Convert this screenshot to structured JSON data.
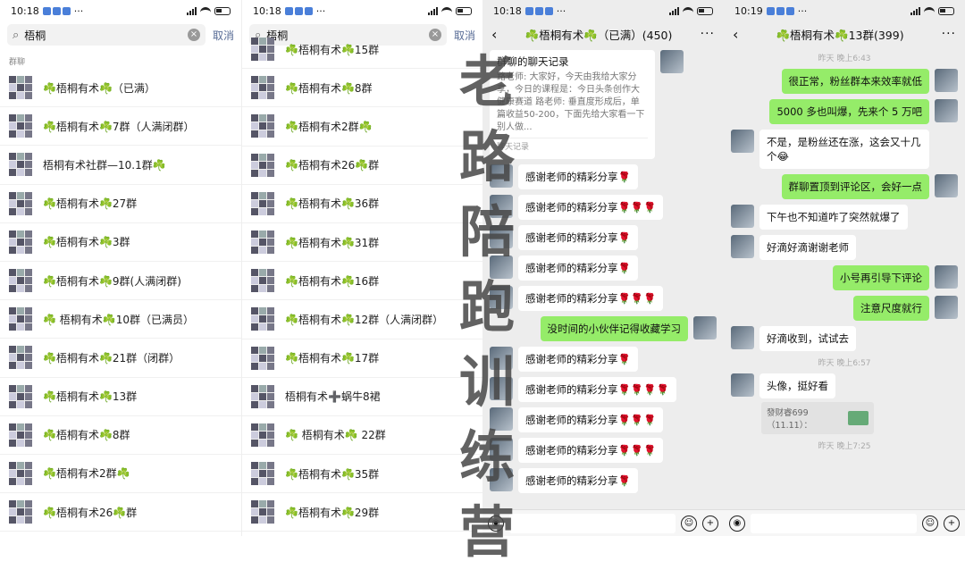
{
  "colors": {
    "bubble_green": "#95ec69",
    "link_blue": "#576b95",
    "clover": "#3aa64a"
  },
  "panel1": {
    "time": "10:18",
    "search_query": "梧桐",
    "cancel": "取消",
    "section": "群聊",
    "groups": [
      "☘️梧桐有术☘️（已满）",
      "☘️梧桐有术☘️7群（人满闭群）",
      "梧桐有术社群—10.1群☘️",
      "☘️梧桐有术☘️27群",
      "☘️梧桐有术☘️3群",
      "☘️梧桐有术☘️9群(人满闭群)",
      "☘️ 梧桐有术☘️10群（已满员）",
      "☘️梧桐有术☘️21群（闭群）",
      "☘️梧桐有术☘️13群",
      "☘️梧桐有术☘️8群",
      "☘️梧桐有术2群☘️",
      "☘️梧桐有术26☘️群"
    ]
  },
  "panel2": {
    "time": "10:18",
    "search_query": "梧桐",
    "cancel": "取消",
    "groups": [
      "☘️梧桐有术☘️15群",
      "☘️梧桐有术☘️8群",
      "☘️梧桐有术2群☘️",
      "☘️梧桐有术26☘️群",
      "☘️梧桐有术☘️36群",
      "☘️梧桐有术☘️31群",
      "☘️梧桐有术☘️16群",
      "☘️梧桐有术☘️12群（人满闭群）",
      "☘️梧桐有术☘️17群",
      "梧桐有术➕蜗牛8裙",
      "☘️ 梧桐有术☘️ 22群",
      "☘️梧桐有术☘️35群",
      "☘️梧桐有术☘️29群"
    ]
  },
  "panel3": {
    "time": "10:18",
    "title": "☘️梧桐有术☘️（已满）(450)",
    "card": {
      "title": "群聊的聊天记录",
      "body": "路老师: 大家好，今天由我给大家分享，今日的课程是：今日头条创作大健康赛道 路老师: 垂直度形成后，单篇收益50-200，下面先给大家看一下别人做...",
      "footer": "聊天记录"
    },
    "messages": [
      {
        "side": "left",
        "text": "感谢老师的精彩分享🌹"
      },
      {
        "side": "left",
        "text": "感谢老师的精彩分享🌹🌹🌹"
      },
      {
        "side": "left",
        "text": "感谢老师的精彩分享🌹"
      },
      {
        "side": "left",
        "text": "感谢老师的精彩分享🌹"
      },
      {
        "side": "left",
        "text": "感谢老师的精彩分享🌹🌹🌹"
      },
      {
        "side": "right",
        "text": "没时间的小伙伴记得收藏学习"
      },
      {
        "side": "left",
        "text": "感谢老师的精彩分享🌹"
      },
      {
        "side": "left",
        "text": "感谢老师的精彩分享🌹🌹🌹🌹"
      },
      {
        "side": "left",
        "text": "感谢老师的精彩分享🌹🌹🌹"
      },
      {
        "side": "left",
        "text": "感谢老师的精彩分享🌹🌹🌹"
      },
      {
        "side": "left",
        "text": "感谢老师的精彩分享🌹"
      }
    ]
  },
  "panel4": {
    "time": "10:19",
    "title": "☘️梧桐有术☘️13群(399)",
    "time1": "昨天 晚上6:43",
    "messages1": [
      {
        "side": "right",
        "text": "很正常，粉丝群本来效率就低"
      },
      {
        "side": "right",
        "text": "5000 多也叫爆，先来个 5 万吧"
      },
      {
        "side": "left",
        "text": "不是，是粉丝还在涨，这会又十几个😂"
      },
      {
        "side": "right",
        "text": "群聊置顶到评论区，会好一点"
      },
      {
        "side": "left",
        "text": "下午也不知道咋了突然就爆了"
      },
      {
        "side": "left",
        "text": "好滴好滴谢谢老师"
      },
      {
        "side": "right",
        "text": "小号再引导下评论"
      },
      {
        "side": "right",
        "text": "注意尺度就行"
      },
      {
        "side": "left",
        "text": "好滴收到，试试去"
      }
    ],
    "time2": "昨天 晚上6:57",
    "messages2": [
      {
        "side": "left",
        "text": "头像，挺好看"
      }
    ],
    "quote": "發财睿699（11.11）：",
    "time3": "昨天 晚上7:25"
  },
  "overlay": [
    "老",
    "路",
    "陪",
    "跑",
    "训",
    "练",
    "营"
  ]
}
